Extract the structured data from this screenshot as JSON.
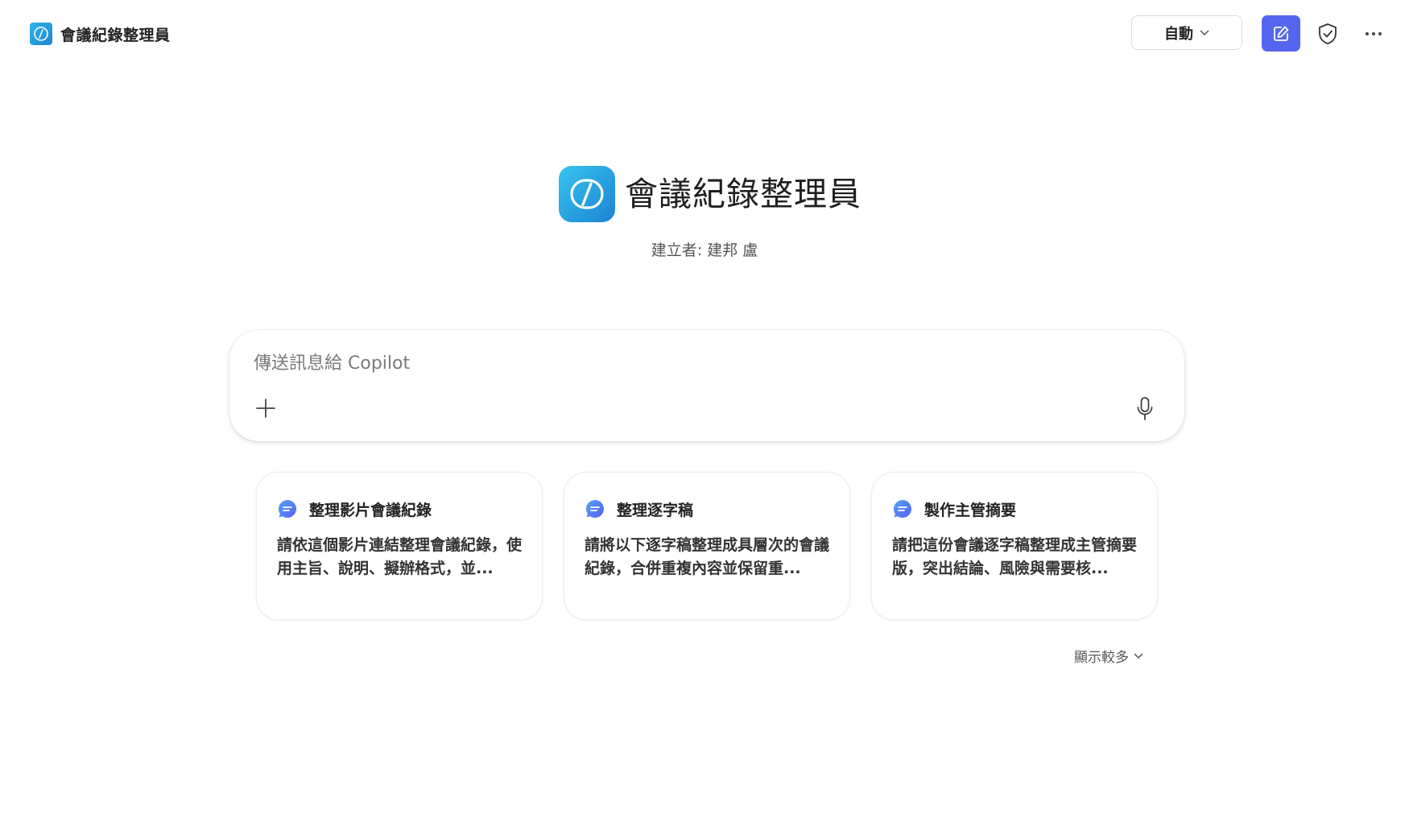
{
  "header": {
    "app_title": "會議紀錄整理員",
    "mode_label": "自動",
    "icons": {
      "logo": "code-brackets-icon",
      "new_chat": "edit-square-icon",
      "shield": "shield-check-icon",
      "more": "more-horizontal-icon"
    },
    "accent_color": "#5566ee"
  },
  "hero": {
    "title": "會議紀錄整理員",
    "creator": "建立者: 建邦 盧"
  },
  "composer": {
    "placeholder": "傳送訊息給 Copilot",
    "value": "",
    "icons": {
      "attach": "plus-icon",
      "mic": "microphone-icon"
    }
  },
  "suggestions": [
    {
      "title": "整理影片會議紀錄",
      "body": "請依這個影片連結整理會議紀錄，使用主旨、說明、擬辦格式，並..."
    },
    {
      "title": "整理逐字稿",
      "body": "請將以下逐字稿整理成具層次的會議紀錄，合併重複內容並保留重..."
    },
    {
      "title": "製作主管摘要",
      "body": "請把這份會議逐字稿整理成主管摘要版，突出結論、風險與需要核..."
    }
  ],
  "show_more_label": "顯示較多"
}
